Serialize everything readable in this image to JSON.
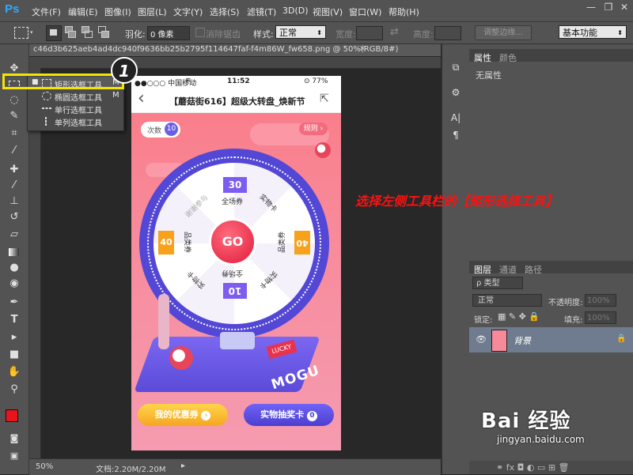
{
  "app": {
    "logo": "Ps"
  },
  "menu": [
    "文件(F)",
    "编辑(E)",
    "图像(I)",
    "图层(L)",
    "文字(Y)",
    "选择(S)",
    "滤镜(T)",
    "3D(D)",
    "视图(V)",
    "窗口(W)",
    "帮助(H)"
  ],
  "window_controls": {
    "minimize": "—",
    "restore": "❐",
    "close": "✕"
  },
  "options": {
    "feather_label": "羽化:",
    "feather_value": "0 像素",
    "antialias_label": "消除锯齿",
    "style_label": "样式:",
    "style_value": "正常",
    "width_label": "宽度:",
    "height_label": "高度:",
    "refine_edge": "调整边缘...",
    "workspace": "基本功能"
  },
  "document": {
    "tab_title": "c46d3b625aeb4ad4dc940f9636bb25b2795f114647faf-f4m86W_fw658.png @ 50%(RGB/8#)",
    "close": "×"
  },
  "flyout": {
    "items": [
      {
        "label": "矩形选框工具",
        "key": "M",
        "selected": true
      },
      {
        "label": "椭圆选框工具",
        "key": "M",
        "selected": false
      },
      {
        "label": "单行选框工具",
        "key": "",
        "selected": false
      },
      {
        "label": "单列选框工具",
        "key": "",
        "selected": false
      }
    ]
  },
  "annotation": {
    "badge": "1",
    "instruction": "选择左侧工具栏的【矩形选择工具】"
  },
  "phone": {
    "carrier": "●●○○○ 中国移动",
    "wifi": "≋",
    "time": "11:52",
    "battery": "⊙ 77%",
    "back": "‹",
    "title": "【蘑菇街616】超级大转盘_焕新节",
    "share": "⇱",
    "count_label": "次数",
    "count_value": "10",
    "rules_label": "规则 ›",
    "go_label": "GO",
    "prize_top": "全场券",
    "prize_top_value": "30",
    "prize_left_value": "40",
    "prize_left": "品类券",
    "prize_right_value": "40",
    "prize_right": "品类券",
    "prize_bottom_value": "10",
    "prize_bottom": "全场券",
    "prize_card_1": "实物卡",
    "prize_card_2": "实物卡",
    "prize_card_3": "实物卡",
    "prize_card_4": "实物卡",
    "prize_none": "谢谢参与",
    "lucky_sign": "LUCKY",
    "brand": "MOGU",
    "btn_coupon": "我的优惠券",
    "btn_card": "实物抽奖卡",
    "btn_card_count": "0"
  },
  "status": {
    "zoom": "50%",
    "doc_label": "文档:2.20M/2.20M",
    "arrow": "▸"
  },
  "properties_panel": {
    "tab1": "属性",
    "tab2": "颜色",
    "content": "无属性"
  },
  "layers_panel": {
    "tabs": [
      "图层",
      "通道",
      "路径"
    ],
    "filter": "ρ 类型",
    "blend_mode": "正常",
    "opacity_label": "不透明度:",
    "opacity_value": "100%",
    "lock_label": "锁定:",
    "fill_label": "填充:",
    "fill_value": "100%",
    "layer_name": "背景"
  },
  "watermark": {
    "logo": "Bai 经验",
    "url": "jingyan.baidu.com"
  },
  "colors": {
    "accent": "#ff1010",
    "highlight": "#f2e500",
    "foreground": "#e8141c",
    "background": "#ffffff"
  }
}
